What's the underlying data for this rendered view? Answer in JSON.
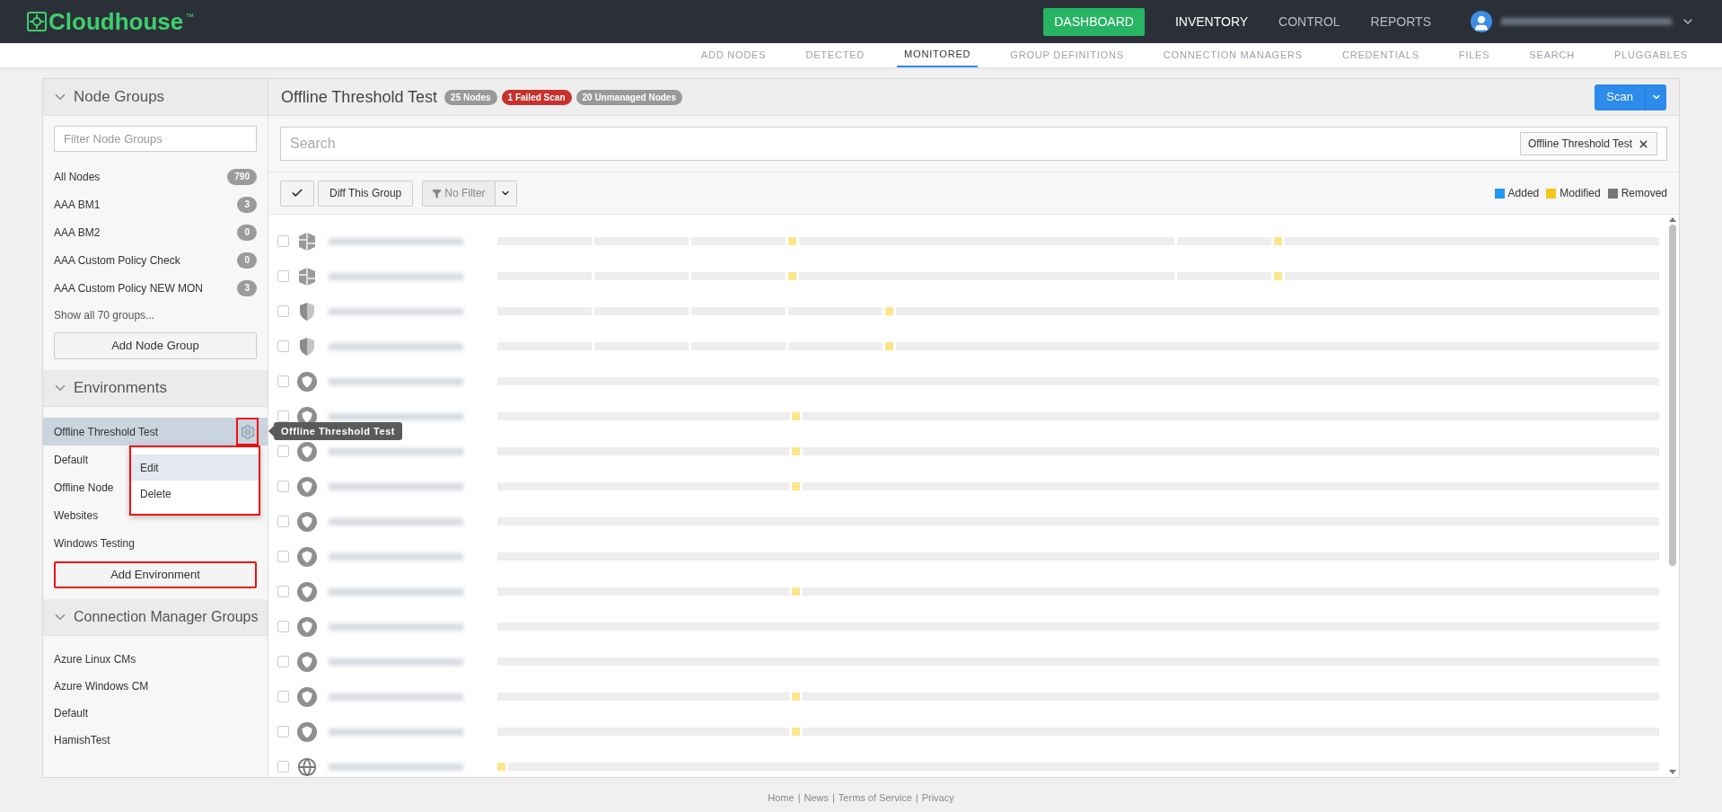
{
  "header": {
    "logo": "Cloudhouse",
    "trademark": "™",
    "nav": [
      {
        "label": "DASHBOARD",
        "kind": "button",
        "selected": false
      },
      {
        "label": "INVENTORY",
        "kind": "link",
        "selected": true
      },
      {
        "label": "CONTROL",
        "kind": "link",
        "selected": false
      },
      {
        "label": "REPORTS",
        "kind": "link",
        "selected": false
      }
    ]
  },
  "subnav": [
    {
      "label": "ADD NODES",
      "selected": false
    },
    {
      "label": "DETECTED",
      "selected": false
    },
    {
      "label": "MONITORED",
      "selected": true
    },
    {
      "label": "GROUP DEFINITIONS",
      "selected": false
    },
    {
      "label": "CONNECTION MANAGERS",
      "selected": false
    },
    {
      "label": "CREDENTIALS",
      "selected": false
    },
    {
      "label": "FILES",
      "selected": false
    },
    {
      "label": "SEARCH",
      "selected": false
    },
    {
      "label": "PLUGGABLES",
      "selected": false
    }
  ],
  "sidebar": {
    "node_groups": {
      "title": "Node Groups",
      "expanded": true,
      "filter_placeholder": "Filter Node Groups",
      "items": [
        {
          "label": "All Nodes",
          "count": "790"
        },
        {
          "label": "AAA BM1",
          "count": "3"
        },
        {
          "label": "AAA BM2",
          "count": "0"
        },
        {
          "label": "AAA Custom Policy Check",
          "count": "0"
        },
        {
          "label": "AAA Custom Policy NEW MON",
          "count": "3"
        }
      ],
      "show_all": "Show all 70 groups...",
      "add_button": "Add Node Group"
    },
    "environments": {
      "title": "Environments",
      "expanded": true,
      "items": [
        {
          "label": "Offline Threshold Test",
          "selected": true
        },
        {
          "label": "Default",
          "selected": false
        },
        {
          "label": "Offline Node",
          "selected": false
        },
        {
          "label": "Websites",
          "selected": false
        },
        {
          "label": "Windows Testing",
          "selected": false
        }
      ],
      "gear_highlighted": true,
      "menu": {
        "highlighted": true,
        "items": [
          {
            "label": "Edit",
            "selected": true
          },
          {
            "label": "Delete",
            "selected": false
          }
        ]
      },
      "tooltip": "Offline Threshold Test",
      "add_button": {
        "label": "Add Environment",
        "highlighted": true
      }
    },
    "cm_groups": {
      "title": "Connection Manager Groups",
      "expanded": true,
      "items": [
        {
          "label": "Azure Linux CMs"
        },
        {
          "label": "Azure Windows CM"
        },
        {
          "label": "Default"
        },
        {
          "label": "HamishTest"
        }
      ]
    }
  },
  "main": {
    "title": "Offline Threshold Test",
    "badges": [
      {
        "label": "25 Nodes",
        "color": "#999999"
      },
      {
        "label": "1 Failed Scan",
        "color": "#c9302c"
      },
      {
        "label": "20 Unmanaged Nodes",
        "color": "#999999"
      }
    ],
    "scan_button": "Scan",
    "search_placeholder": "Search",
    "search_tag": "Offline Threshold Test",
    "diff_button": "Diff This Group",
    "filter_button": "No Filter",
    "legend": [
      {
        "label": "Added",
        "color": "#2196f3"
      },
      {
        "label": "Modified",
        "color": "#f5c518"
      },
      {
        "label": "Removed",
        "color": "#777777"
      }
    ],
    "rows": [
      {
        "kind": "cube",
        "checked": false,
        "segments": [
          {
            "kind": "short"
          },
          {
            "kind": "short"
          },
          {
            "kind": "short"
          },
          {
            "kind": "modified"
          },
          {
            "kind": "long"
          },
          {
            "kind": "short"
          },
          {
            "kind": "modified"
          },
          {
            "kind": "long"
          }
        ]
      },
      {
        "kind": "cube",
        "checked": false,
        "segments": [
          {
            "kind": "short"
          },
          {
            "kind": "short"
          },
          {
            "kind": "short"
          },
          {
            "kind": "modified"
          },
          {
            "kind": "long"
          },
          {
            "kind": "short"
          },
          {
            "kind": "modified"
          },
          {
            "kind": "long"
          }
        ]
      },
      {
        "kind": "shield",
        "checked": false,
        "segments": [
          {
            "kind": "short"
          },
          {
            "kind": "short"
          },
          {
            "kind": "short"
          },
          {
            "kind": "short"
          },
          {
            "kind": "modified"
          },
          {
            "kind": "long"
          }
        ]
      },
      {
        "kind": "shield",
        "checked": false,
        "segments": [
          {
            "kind": "short"
          },
          {
            "kind": "short"
          },
          {
            "kind": "short"
          },
          {
            "kind": "short"
          },
          {
            "kind": "modified"
          },
          {
            "kind": "long"
          }
        ]
      },
      {
        "kind": "badge",
        "checked": false,
        "segments": [
          {
            "kind": "long"
          }
        ]
      },
      {
        "kind": "badge",
        "checked": false,
        "segments": [
          {
            "kind": "medium"
          },
          {
            "kind": "modified"
          },
          {
            "kind": "long"
          }
        ]
      },
      {
        "kind": "badge",
        "checked": false,
        "segments": [
          {
            "kind": "medium"
          },
          {
            "kind": "modified"
          },
          {
            "kind": "long"
          }
        ]
      },
      {
        "kind": "badge",
        "checked": false,
        "segments": [
          {
            "kind": "medium"
          },
          {
            "kind": "modified"
          },
          {
            "kind": "long"
          }
        ]
      },
      {
        "kind": "badge",
        "checked": false,
        "segments": [
          {
            "kind": "long"
          }
        ]
      },
      {
        "kind": "badge",
        "checked": false,
        "segments": [
          {
            "kind": "long"
          }
        ]
      },
      {
        "kind": "badge",
        "checked": false,
        "segments": [
          {
            "kind": "medium"
          },
          {
            "kind": "modified"
          },
          {
            "kind": "long"
          }
        ]
      },
      {
        "kind": "badge",
        "checked": false,
        "segments": [
          {
            "kind": "long"
          }
        ]
      },
      {
        "kind": "badge",
        "checked": false,
        "segments": [
          {
            "kind": "long"
          }
        ]
      },
      {
        "kind": "badge",
        "checked": false,
        "segments": [
          {
            "kind": "medium"
          },
          {
            "kind": "modified"
          },
          {
            "kind": "long"
          }
        ]
      },
      {
        "kind": "badge",
        "checked": false,
        "segments": [
          {
            "kind": "medium"
          },
          {
            "kind": "modified"
          },
          {
            "kind": "long"
          }
        ]
      },
      {
        "kind": "globe",
        "checked": false,
        "segments": [
          {
            "kind": "modified"
          },
          {
            "kind": "long"
          }
        ]
      }
    ]
  },
  "footer": [
    {
      "label": "Home"
    },
    {
      "label": "News"
    },
    {
      "label": "Terms of Service"
    },
    {
      "label": "Privacy"
    }
  ],
  "footer_separator": "|"
}
